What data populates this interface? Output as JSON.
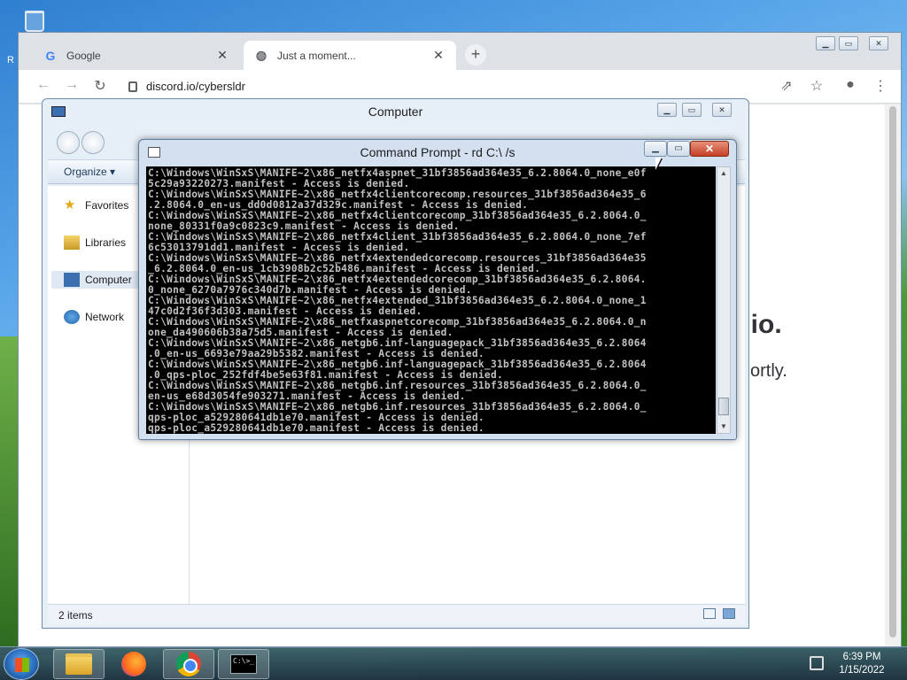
{
  "desktop": {
    "recycle_label": "R"
  },
  "browser": {
    "tabs": [
      {
        "label": "Google",
        "icon": "google-icon"
      },
      {
        "label": "Just a moment...",
        "icon": "globe-icon"
      }
    ],
    "new_tab": "+",
    "url": "discord.io/cybersldr",
    "page_heading": "l.io.",
    "page_sub": "ortly."
  },
  "explorer": {
    "title": "Computer",
    "organize": "Organize ▾",
    "nav_items": [
      "Favorites",
      "Libraries",
      "Computer",
      "Network"
    ],
    "status": "2 items"
  },
  "cmd": {
    "title": "Command Prompt - rd  C:\\ /s",
    "lines": [
      "C:\\Windows\\WinSxS\\MANIFE~2\\x86_netfx4aspnet_31bf3856ad364e35_6.2.8064.0_none_e0f",
      "5c29a93220273.manifest - Access is denied.",
      "C:\\Windows\\WinSxS\\MANIFE~2\\x86_netfx4clientcorecomp.resources_31bf3856ad364e35_6",
      ".2.8064.0_en-us_dd0d0812a37d329c.manifest - Access is denied.",
      "C:\\Windows\\WinSxS\\MANIFE~2\\x86_netfx4clientcorecomp_31bf3856ad364e35_6.2.8064.0_",
      "none_80331f0a9c0823c9.manifest - Access is denied.",
      "C:\\Windows\\WinSxS\\MANIFE~2\\x86_netfx4client_31bf3856ad364e35_6.2.8064.0_none_7ef",
      "6c53013791dd1.manifest - Access is denied.",
      "C:\\Windows\\WinSxS\\MANIFE~2\\x86_netfx4extendedcorecomp.resources_31bf3856ad364e35",
      "_6.2.8064.0_en-us_1cb3908b2c52b486.manifest - Access is denied.",
      "C:\\Windows\\WinSxS\\MANIFE~2\\x86_netfx4extendedcorecomp_31bf3856ad364e35_6.2.8064.",
      "0_none_6270a7976c340d7b.manifest - Access is denied.",
      "C:\\Windows\\WinSxS\\MANIFE~2\\x86_netfx4extended_31bf3856ad364e35_6.2.8064.0_none_1",
      "47c0d2f36f3d303.manifest - Access is denied.",
      "C:\\Windows\\WinSxS\\MANIFE~2\\x86_netfxaspnetcorecomp_31bf3856ad364e35_6.2.8064.0_n",
      "one_da490606b38a75d5.manifest - Access is denied.",
      "C:\\Windows\\WinSxS\\MANIFE~2\\x86_netgb6.inf-languagepack_31bf3856ad364e35_6.2.8064",
      ".0_en-us_6693e79aa29b5382.manifest - Access is denied.",
      "C:\\Windows\\WinSxS\\MANIFE~2\\x86_netgb6.inf-languagepack_31bf3856ad364e35_6.2.8064",
      ".0_qps-ploc_252fdf4be5e63f81.manifest - Access is denied.",
      "C:\\Windows\\WinSxS\\MANIFE~2\\x86_netgb6.inf.resources_31bf3856ad364e35_6.2.8064.0_",
      "en-us_e68d3054fe903271.manifest - Access is denied.",
      "C:\\Windows\\WinSxS\\MANIFE~2\\x86_netgb6.inf.resources_31bf3856ad364e35_6.2.8064.0_",
      "qps-ploc_a529280641db1e70.manifest - Access is denied.",
      "qps-ploc_a529280641db1e70.manifest - Access is denied."
    ]
  },
  "taskbar": {
    "apps": [
      "folder-icon",
      "firefox-icon",
      "chrome-icon",
      "cmd-icon"
    ],
    "cmd_icon_text": "C:\\>_",
    "time": "6:39 PM",
    "date": "1/15/2022"
  }
}
